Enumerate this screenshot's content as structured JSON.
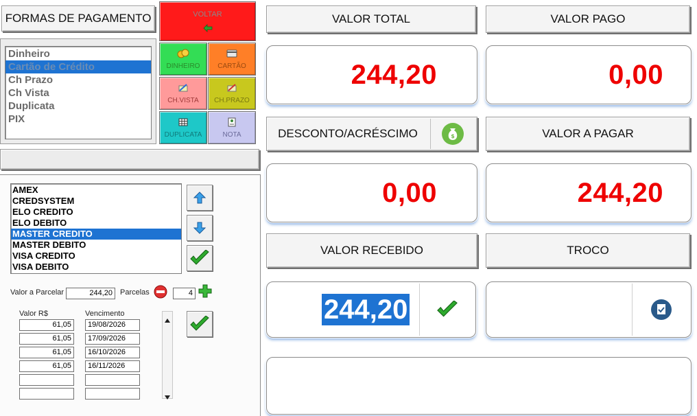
{
  "payment_methods": {
    "title": "FORMAS DE PAGAMENTO",
    "items": [
      "Dinheiro",
      "Cartão de Crédito",
      "Ch Prazo",
      "Ch Vista",
      "Duplicata",
      "PIX"
    ],
    "selected_index": 1
  },
  "tiles": {
    "voltar": "VOLTAR",
    "dinheiro": "DINHEIRO",
    "cartao": "CARTÃO",
    "chvista": "CH.VISTA",
    "chprazo": "CH.PRAZO",
    "duplicata": "DUPLICATA",
    "nota": "NOTA"
  },
  "cards": {
    "items": [
      "AMEX",
      "CREDSYSTEM",
      "ELO CREDITO",
      "ELO DEBITO",
      "MASTER CREDITO",
      "MASTER DEBITO",
      "VISA CREDITO",
      "VISA DEBITO"
    ],
    "selected_index": 4
  },
  "installments": {
    "valor_label": "Valor a Parcelar",
    "valor": "244,20",
    "parcelas_label": "Parcelas",
    "parcelas": "4",
    "col_valor": "Valor R$",
    "col_venc": "Vencimento",
    "rows": [
      {
        "valor": "61,05",
        "venc": "19/08/2026"
      },
      {
        "valor": "61,05",
        "venc": "17/09/2026"
      },
      {
        "valor": "61,05",
        "venc": "16/10/2026"
      },
      {
        "valor": "61,05",
        "venc": "16/11/2026"
      },
      {
        "valor": "",
        "venc": ""
      },
      {
        "valor": "",
        "venc": ""
      }
    ]
  },
  "summary": {
    "valor_total_label": "VALOR TOTAL",
    "valor_total": "244,20",
    "valor_pago_label": "VALOR PAGO",
    "valor_pago": "0,00",
    "desconto_label": "DESCONTO/ACRÉSCIMO",
    "desconto": "0,00",
    "valor_a_pagar_label": "VALOR A PAGAR",
    "valor_a_pagar": "244,20",
    "valor_recebido_label": "VALOR RECEBIDO",
    "valor_recebido": "244,20",
    "troco_label": "TROCO",
    "troco": ""
  },
  "colors": {
    "value_red": "#ee0000",
    "selection_blue": "#1e73d2",
    "voltar_bg": "#ff1a1a",
    "dinheiro_bg": "#33dd55",
    "cartao_bg": "#ff7f27",
    "chvista_bg": "#ff9a9a",
    "chprazo_bg": "#c8c81e",
    "duplicata_bg": "#1ec8c8",
    "nota_bg": "#c8c8f0"
  }
}
